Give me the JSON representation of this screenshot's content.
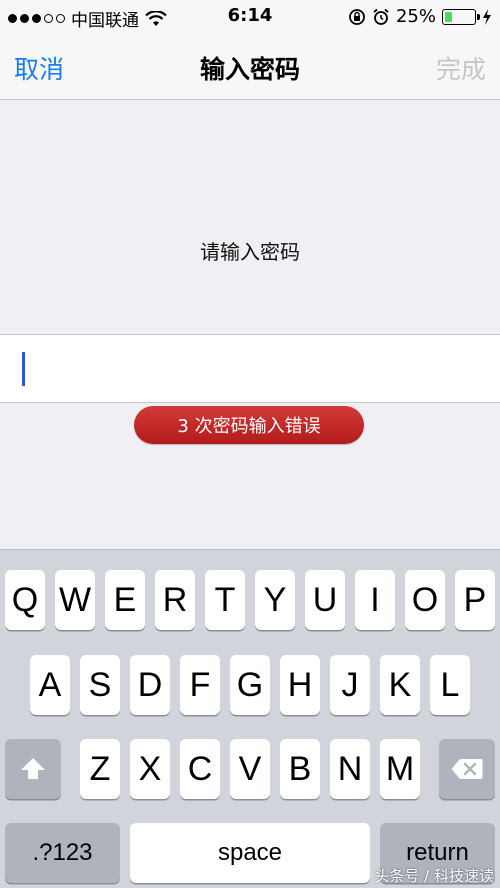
{
  "status_bar": {
    "carrier": "中国联通",
    "time": "6:14",
    "battery_percent_text": "25%",
    "battery_level": 0.25
  },
  "nav": {
    "cancel_label": "取消",
    "title": "输入密码",
    "done_label": "完成"
  },
  "content": {
    "prompt": "请输入密码",
    "error_message": "3 次密码输入错误"
  },
  "keyboard": {
    "row1": [
      "Q",
      "W",
      "E",
      "R",
      "T",
      "Y",
      "U",
      "I",
      "O",
      "P"
    ],
    "row2": [
      "A",
      "S",
      "D",
      "F",
      "G",
      "H",
      "J",
      "K",
      "L"
    ],
    "row3": [
      "Z",
      "X",
      "C",
      "V",
      "B",
      "N",
      "M"
    ],
    "numbers_label": ".?123",
    "space_label": "space",
    "return_label": "return"
  },
  "watermark": "头条号 / 科技速读",
  "colors": {
    "accent": "#1a7cf5",
    "error": "#c42828",
    "disabled": "#c6c6c8",
    "battery": "#4cd964"
  }
}
